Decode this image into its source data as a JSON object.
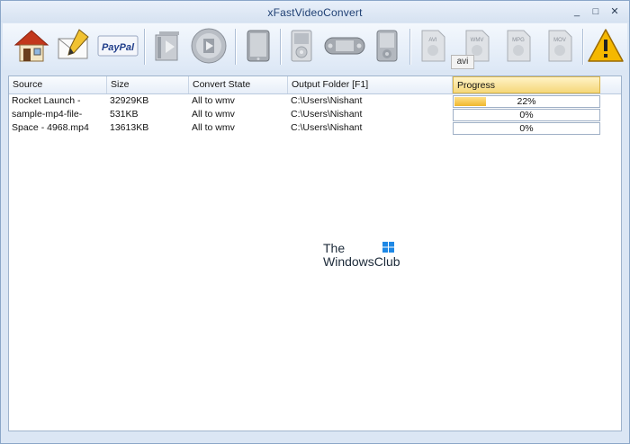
{
  "window": {
    "title": "xFastVideoConvert",
    "minimize": "_",
    "maximize": "□",
    "close": "✕"
  },
  "tooltip": "avi",
  "toolbar": {
    "buttons": [
      {
        "name": "home-icon"
      },
      {
        "name": "edit-mail-icon"
      },
      {
        "name": "paypal-icon",
        "label": "PayPal"
      },
      {
        "name": "video-add-icon"
      },
      {
        "name": "video-play-icon"
      },
      {
        "name": "ipad-icon"
      },
      {
        "name": "ipod-icon"
      },
      {
        "name": "psp-icon"
      },
      {
        "name": "zune-icon"
      },
      {
        "name": "avi-file-icon",
        "label": "AVI"
      },
      {
        "name": "wmv-file-icon",
        "label": "WMV"
      },
      {
        "name": "mpg-file-icon",
        "label": "MPG"
      },
      {
        "name": "mov-file-icon",
        "label": "MOV"
      },
      {
        "name": "warning-icon"
      }
    ]
  },
  "table": {
    "columns": [
      "Source",
      "Size",
      "Convert State",
      "Output Folder [F1]",
      "Progress"
    ],
    "rows": [
      {
        "source": "Rocket Launch -",
        "size": "32929KB",
        "state": "All to wmv",
        "output": "C:\\Users\\Nishant",
        "progress": "22%",
        "progress_value": 0.22
      },
      {
        "source": "sample-mp4-file-",
        "size": "531KB",
        "state": "All to wmv",
        "output": "C:\\Users\\Nishant",
        "progress": "0%",
        "progress_value": 0
      },
      {
        "source": "Space - 4968.mp4",
        "size": "13613KB",
        "state": "All to wmv",
        "output": "C:\\Users\\Nishant",
        "progress": "0%",
        "progress_value": 0
      }
    ]
  },
  "watermark": {
    "line1": "The",
    "line2": "WindowsClub"
  },
  "colors": {
    "accent": "#f0b72d",
    "title_text": "#1e3f73",
    "warning": "#f5b800",
    "home_roof": "#c2381c",
    "paypal_blue": "#1f3d8a"
  }
}
